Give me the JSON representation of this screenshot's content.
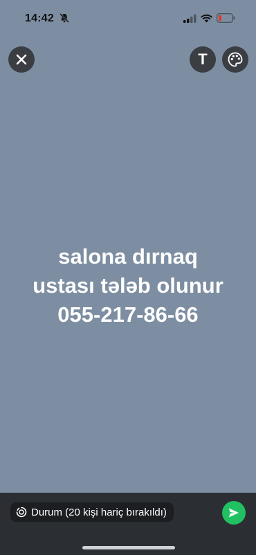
{
  "status_bar": {
    "time": "14:42",
    "icons": [
      "bell-slash-icon",
      "cellular-signal-icon",
      "wifi-icon",
      "battery-low-icon"
    ]
  },
  "toolbar": {
    "close_icon": "close-icon",
    "text_tool_label": "T",
    "palette_icon": "palette-icon"
  },
  "story": {
    "background_color": "#7d8ea2",
    "lines": [
      "salona dırnaq",
      "ustası tələb olunur",
      "055-217-86-66"
    ]
  },
  "footer": {
    "audience_label": "Durum (20 kişi hariç bırakıldı)",
    "audience_icon": "status-ring-icon",
    "send_icon": "send-icon",
    "send_color": "#21c063"
  }
}
